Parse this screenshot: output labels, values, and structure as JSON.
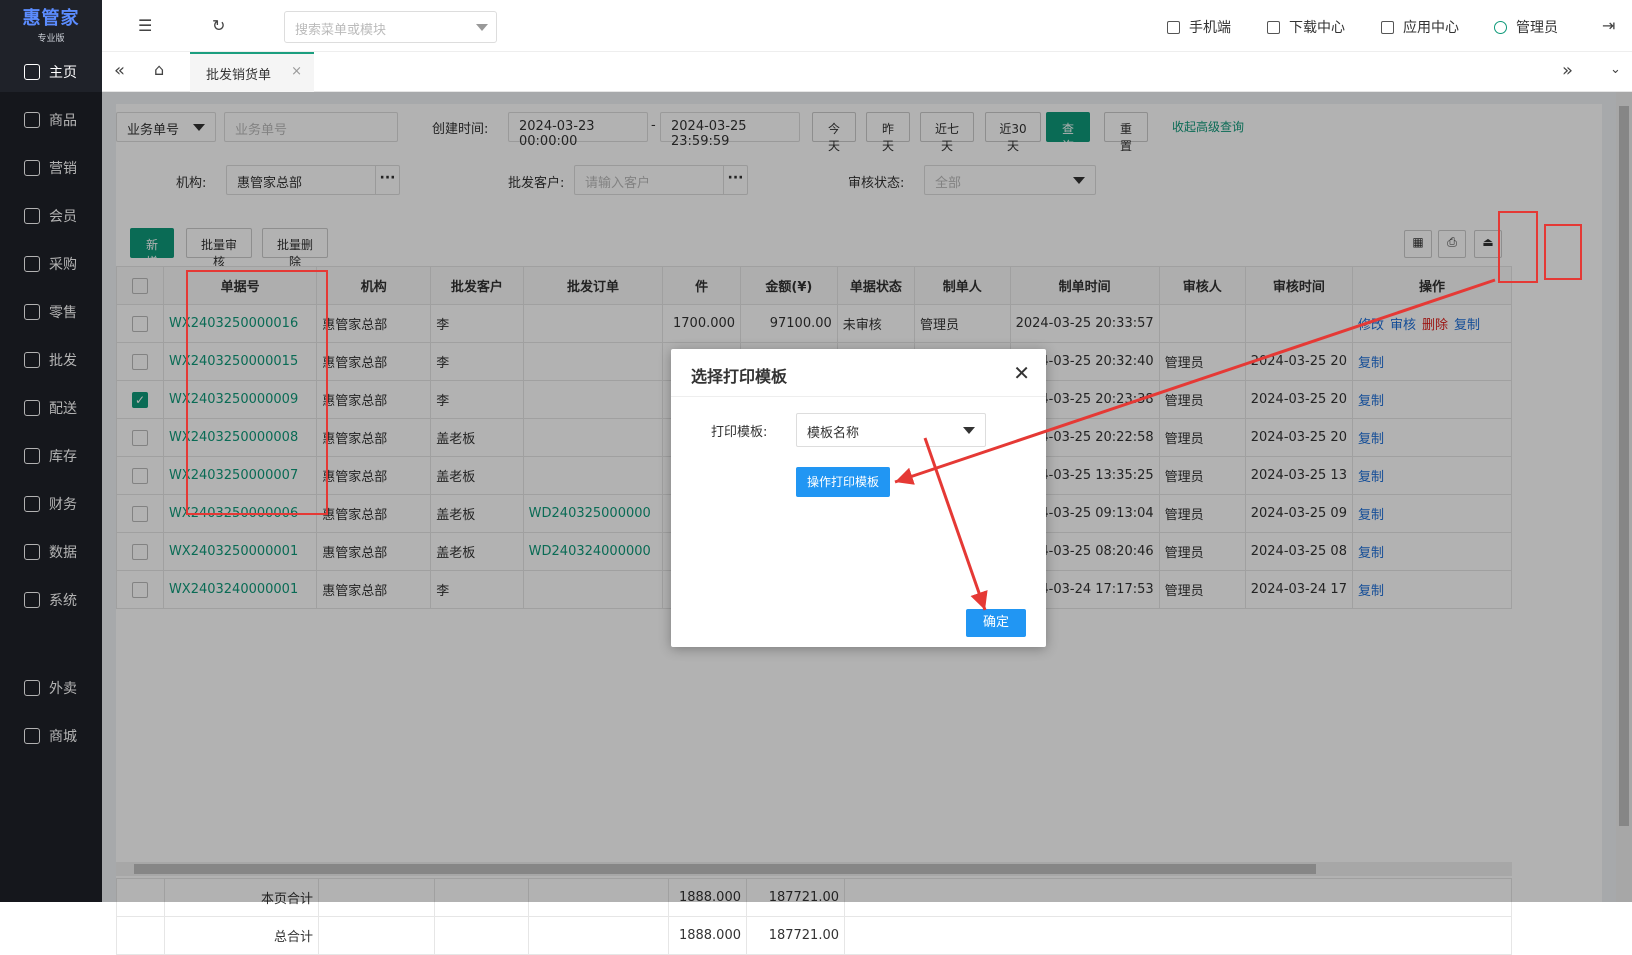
{
  "logo": {
    "main": "惠管家",
    "sub": "专业版"
  },
  "sidebar": {
    "items": [
      {
        "label": "主页",
        "icon": "home-icon"
      },
      {
        "label": "商品",
        "icon": "box-icon"
      },
      {
        "label": "营销",
        "icon": "chart-icon"
      },
      {
        "label": "会员",
        "icon": "heart-icon"
      },
      {
        "label": "采购",
        "icon": "cart-icon"
      },
      {
        "label": "零售",
        "icon": "bag-icon"
      },
      {
        "label": "批发",
        "icon": "building-icon"
      },
      {
        "label": "配送",
        "icon": "truck-icon"
      },
      {
        "label": "库存",
        "icon": "store-icon"
      },
      {
        "label": "财务",
        "icon": "yen-icon"
      },
      {
        "label": "数据",
        "icon": "bars-icon"
      },
      {
        "label": "系统",
        "icon": "gear-icon"
      }
    ],
    "extra": [
      {
        "label": "外卖",
        "icon": "bike-icon"
      },
      {
        "label": "商城",
        "icon": "shop-icon"
      }
    ]
  },
  "header": {
    "search_placeholder": "搜索菜单或模块",
    "mobile": "手机端",
    "download": "下载中心",
    "apps": "应用中心",
    "user": "管理员"
  },
  "tabs": {
    "active": "批发销货单"
  },
  "filters": {
    "type_select": "业务单号",
    "order_no_placeholder": "业务单号",
    "created_label": "创建时间:",
    "date_start": "2024-03-23 00:00:00",
    "date_sep": "-",
    "date_end": "2024-03-25 23:59:59",
    "btn_today": "今天",
    "btn_yesterday": "昨天",
    "btn_7": "近七天",
    "btn_30": "近30天",
    "btn_query": "查询",
    "btn_reset": "重置",
    "advanced": "收起高级查询",
    "org_label": "机构:",
    "org_value": "惠管家总部",
    "customer_label": "批发客户:",
    "customer_placeholder": "请输入客户",
    "status_label": "审核状态:",
    "status_value": "全部"
  },
  "toolbar": {
    "add": "新增",
    "batch_review": "批量审核",
    "batch_delete": "批量删除"
  },
  "table": {
    "headers": [
      "单据号",
      "机构",
      "批发客户",
      "批发订单",
      "件",
      "金额(¥)",
      "单据状态",
      "制单人",
      "制单时间",
      "审核人",
      "审核时间",
      "操作"
    ],
    "rows": [
      {
        "no": "WX2403250000016",
        "org": "惠管家总部",
        "customer": "李",
        "order": "",
        "qty": "1700.000",
        "amount": "97100.00",
        "status": "未审核",
        "maker": "管理员",
        "time": "2024-03-25 20:33:57",
        "reviewer": "",
        "rtime": "",
        "ops": [
          "修改",
          "审核",
          "删除",
          "复制"
        ],
        "checked": false
      },
      {
        "no": "WX2403250000015",
        "org": "惠管家总部",
        "customer": "李",
        "order": "",
        "qty": "",
        "amount": "",
        "status": "",
        "maker": "",
        "time": "2024-03-25 20:32:40",
        "reviewer": "管理员",
        "rtime": "2024-03-25 20",
        "ops": [
          "复制"
        ],
        "checked": false
      },
      {
        "no": "WX2403250000009",
        "org": "惠管家总部",
        "customer": "李",
        "order": "",
        "qty": "",
        "amount": "",
        "status": "",
        "maker": "",
        "time": "2024-03-25 20:23:38",
        "reviewer": "管理员",
        "rtime": "2024-03-25 20",
        "ops": [
          "复制"
        ],
        "checked": true
      },
      {
        "no": "WX2403250000008",
        "org": "惠管家总部",
        "customer": "盖老板",
        "order": "",
        "qty": "",
        "amount": "",
        "status": "",
        "maker": "",
        "time": "2024-03-25 20:22:58",
        "reviewer": "管理员",
        "rtime": "2024-03-25 20",
        "ops": [
          "复制"
        ],
        "checked": false
      },
      {
        "no": "WX2403250000007",
        "org": "惠管家总部",
        "customer": "盖老板",
        "order": "",
        "qty": "",
        "amount": "",
        "status": "",
        "maker": "",
        "time": "2024-03-25 13:35:25",
        "reviewer": "管理员",
        "rtime": "2024-03-25 13",
        "ops": [
          "复制"
        ],
        "checked": false
      },
      {
        "no": "WX2403250000006",
        "org": "惠管家总部",
        "customer": "盖老板",
        "order": "WD240325000000",
        "qty": "",
        "amount": "",
        "status": "",
        "maker": "",
        "time": "2024-03-25 09:13:04",
        "reviewer": "管理员",
        "rtime": "2024-03-25 09",
        "ops": [
          "复制"
        ],
        "checked": false
      },
      {
        "no": "WX2403250000001",
        "org": "惠管家总部",
        "customer": "盖老板",
        "order": "WD240324000000",
        "qty": "",
        "amount": "",
        "status": "",
        "maker": "",
        "time": "2024-03-25 08:20:46",
        "reviewer": "管理员",
        "rtime": "2024-03-25 08",
        "ops": [
          "复制"
        ],
        "checked": false
      },
      {
        "no": "WX2403240000001",
        "org": "惠管家总部",
        "customer": "李",
        "order": "",
        "qty": "",
        "amount": "",
        "status": "",
        "maker": "",
        "time": "2024-03-24 17:17:53",
        "reviewer": "管理员",
        "rtime": "2024-03-24 17",
        "ops": [
          "复制"
        ],
        "checked": false
      }
    ],
    "page_total_label": "本页合计",
    "page_qty": "1888.000",
    "page_amount": "187721.00",
    "grand_total_label": "总合计",
    "grand_qty": "1888.000",
    "grand_amount": "187721.00"
  },
  "dialog": {
    "title": "选择打印模板",
    "label": "打印模板:",
    "select_value": "模板名称",
    "op_button": "操作打印模板",
    "confirm": "确定"
  },
  "colors": {
    "accent": "#0f9a7a",
    "primary_blue": "#2196f3",
    "annotation_red": "#e53935"
  }
}
